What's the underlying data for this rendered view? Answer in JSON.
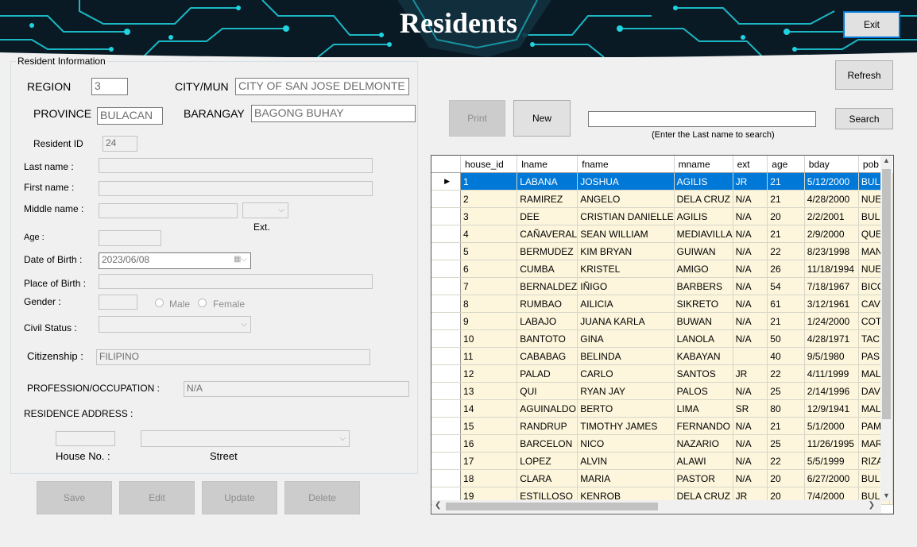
{
  "header": {
    "title": "Residents",
    "exit_label": "Exit"
  },
  "toolbar": {
    "refresh_label": "Refresh",
    "print_label": "Print",
    "new_label": "New",
    "search_label": "Search",
    "search_value": "",
    "search_hint": "(Enter the Last name to search)"
  },
  "form": {
    "group_title": "Resident Information",
    "region": {
      "label": "REGION",
      "value": "3"
    },
    "city": {
      "label": "CITY/MUN",
      "value": "CITY OF SAN JOSE DELMONTE"
    },
    "province": {
      "label": "PROVINCE",
      "value": "BULACAN"
    },
    "barangay": {
      "label": "BARANGAY",
      "value": "BAGONG BUHAY"
    },
    "resident_id": {
      "label": "Resident ID",
      "value": "24"
    },
    "last_name": {
      "label": "Last name :",
      "value": ""
    },
    "first_name": {
      "label": "First name :",
      "value": ""
    },
    "middle_name": {
      "label": "Middle name :",
      "value": ""
    },
    "ext": {
      "label": "Ext.",
      "value": ""
    },
    "age": {
      "label": "Age :",
      "value": ""
    },
    "dob": {
      "label": "Date of Birth :",
      "value": "2023/06/08"
    },
    "pob": {
      "label": "Place of Birth :",
      "value": ""
    },
    "gender": {
      "label": "Gender :",
      "value": "",
      "male": "Male",
      "female": "Female"
    },
    "civil_status": {
      "label": "Civil Status :",
      "value": ""
    },
    "citizenship": {
      "label": "Citizenship :",
      "value": "FILIPINO"
    },
    "profession": {
      "label": "PROFESSION/OCCUPATION :",
      "value": "N/A"
    },
    "address": {
      "label": "RESIDENCE ADDRESS :",
      "house_label": "House No. :",
      "street_label": "Street",
      "house_value": "",
      "street_value": ""
    }
  },
  "actions": {
    "save": "Save",
    "edit": "Edit",
    "update": "Update",
    "delete": "Delete"
  },
  "grid": {
    "columns": [
      "house_id",
      "lname",
      "fname",
      "mname",
      "ext",
      "age",
      "bday",
      "pob"
    ],
    "rows": [
      [
        "1",
        "LABANA",
        "JOSHUA",
        "AGILIS",
        "JR",
        "21",
        "5/12/2000",
        "BUL"
      ],
      [
        "2",
        "RAMIREZ",
        "ANGELO",
        "DELA CRUZ",
        "N/A",
        "21",
        "4/28/2000",
        "NUE"
      ],
      [
        "3",
        "DEE",
        "CRISTIAN DANIELLE",
        "AGILIS",
        "N/A",
        "20",
        "2/2/2001",
        "BUL"
      ],
      [
        "4",
        "CAÑAVERAL",
        "SEAN WILLIAM",
        "MEDIAVILLA",
        "N/A",
        "21",
        "2/9/2000",
        "QUE"
      ],
      [
        "5",
        "BERMUDEZ",
        "KIM BRYAN",
        "GUIWAN",
        "N/A",
        "22",
        "8/23/1998",
        "MAN"
      ],
      [
        "6",
        "CUMBA",
        "KRISTEL",
        "AMIGO",
        "N/A",
        "26",
        "11/18/1994",
        "NUE"
      ],
      [
        "7",
        "BERNALDEZ",
        "IÑIGO",
        "BARBERS",
        "N/A",
        "54",
        "7/18/1967",
        "BICO"
      ],
      [
        "8",
        "RUMBAO",
        "AILICIA",
        "SIKRETO",
        "N/A",
        "61",
        "3/12/1961",
        "CAV"
      ],
      [
        "9",
        "LABAJO",
        "JUANA KARLA",
        "BUWAN",
        "N/A",
        "21",
        "1/24/2000",
        "COT"
      ],
      [
        "10",
        "BANTOTO",
        "GINA",
        "LANOLA",
        "N/A",
        "50",
        "4/28/1971",
        "TAC"
      ],
      [
        "11",
        "CABABAG",
        "BELINDA",
        "KABAYAN",
        "",
        "40",
        "9/5/1980",
        "PAS"
      ],
      [
        "12",
        "PALAD",
        "CARLO",
        "SANTOS",
        "JR",
        "22",
        "4/11/1999",
        "MAL"
      ],
      [
        "13",
        "QUI",
        "RYAN JAY",
        "PALOS",
        "N/A",
        "25",
        "2/14/1996",
        "DAV"
      ],
      [
        "14",
        "AGUINALDO",
        "BERTO",
        "LIMA",
        "SR",
        "80",
        "12/9/1941",
        "MAL"
      ],
      [
        "15",
        "RANDRUP",
        "TIMOTHY JAMES",
        "FERNANDO",
        "N/A",
        "21",
        "5/1/2000",
        "PAM"
      ],
      [
        "16",
        "BARCELON",
        "NICO",
        "NAZARIO",
        "N/A",
        "25",
        "11/26/1995",
        "MAR"
      ],
      [
        "17",
        "LOPEZ",
        "ALVIN",
        "ALAWI",
        "N/A",
        "22",
        "5/5/1999",
        "RIZA"
      ],
      [
        "18",
        "CLARA",
        "MARIA",
        "PASTOR",
        "N/A",
        "20",
        "6/27/2000",
        "BUL"
      ],
      [
        "19",
        "ESTILLOSO",
        "KENROB",
        "DELA CRUZ",
        "JR",
        "20",
        "7/4/2000",
        "BUL"
      ]
    ],
    "selected_row": 0
  },
  "colors": {
    "selection": "#0078d7",
    "row_bg": "#fdf6dc",
    "banner_bg": "#0a1a24",
    "banner_accent": "#1fd3e0"
  }
}
